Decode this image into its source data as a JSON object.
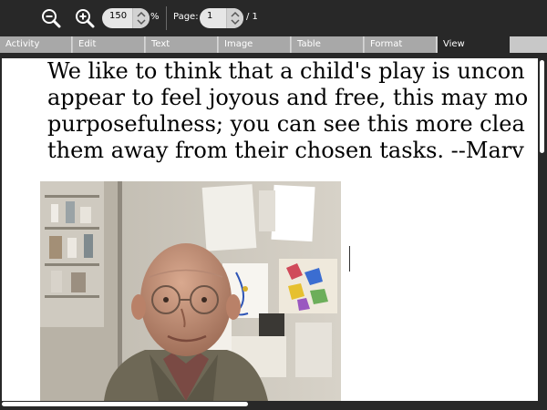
{
  "toolbar": {
    "zoom_value": "150",
    "zoom_unit": "%",
    "page_label": "Page:",
    "page_value": "1",
    "page_total": "/ 1",
    "icons": [
      "zoom-out-icon",
      "zoom-in-icon"
    ]
  },
  "tabs": [
    {
      "label": "Activity",
      "active": false
    },
    {
      "label": "Edit",
      "active": false
    },
    {
      "label": "Text",
      "active": false
    },
    {
      "label": "Image",
      "active": false
    },
    {
      "label": "Table",
      "active": false
    },
    {
      "label": "Format",
      "active": false
    },
    {
      "label": "View",
      "active": true
    }
  ],
  "document": {
    "lines": [
      "We like to think that a child's play is uncon",
      "appear to feel joyous and free, this may mo",
      "purposefulness; you can see this more clea",
      "them away from their chosen tasks. --Marv"
    ]
  },
  "colors": {
    "toolbar_bg": "#282828",
    "tab_inactive": "#a8a8a8",
    "tab_active": "#282828",
    "page_bg": "#ffffff"
  }
}
